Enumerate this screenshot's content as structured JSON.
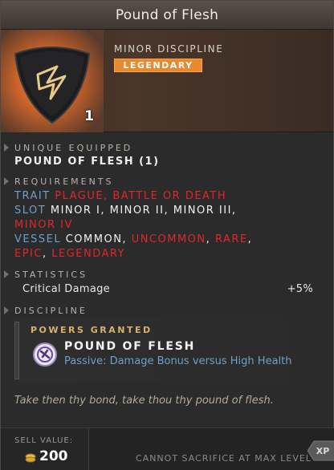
{
  "item": {
    "title": "Pound of Flesh",
    "subtype": "MINOR DISCIPLINE",
    "rarity": "LEGENDARY",
    "count": "1",
    "icon": "discipline-shield-icon"
  },
  "unique": {
    "heading": "UNIQUE EQUIPPED",
    "value": "POUND OF FLESH (1)"
  },
  "requirements": {
    "heading": "REQUIREMENTS",
    "trait_label": "TRAIT",
    "trait_value": "PLAGUE, BATTLE OR DEATH",
    "slot_label": "SLOT",
    "slot_value_1": "MINOR I, MINOR II, MINOR III,",
    "slot_value_2": "MINOR IV",
    "vessel_label": "VESSEL",
    "vessel_common": "COMMON",
    "comma": ",",
    "vessel_uncommon": "UNCOMMON",
    "vessel_rare": "RARE",
    "vessel_epic": "EPIC",
    "vessel_legendary": "LEGENDARY"
  },
  "statistics": {
    "heading": "STATISTICS",
    "stat_name": "Critical Damage",
    "stat_value": "+5%"
  },
  "discipline": {
    "heading": "DISCIPLINE",
    "powers_label": "POWERS GRANTED",
    "power_name": "POUND OF FLESH",
    "power_desc": "Passive: Damage Bonus versus High Health",
    "power_icon": "pound-of-flesh-power-icon"
  },
  "flavor": "Take then thy bond, take thou thy pound of flesh.",
  "footer": {
    "sell_label": "SELL VALUE:",
    "sell_value": "200",
    "sacrifice": "CANNOT SACRIFICE AT MAX LEVEL",
    "xp_badge": "XP"
  },
  "colors": {
    "legendary": "#e8892e",
    "requirement_label": "#6f9fc9",
    "unmet_requirement": "#e0272a",
    "powers_label": "#d7b26b"
  }
}
